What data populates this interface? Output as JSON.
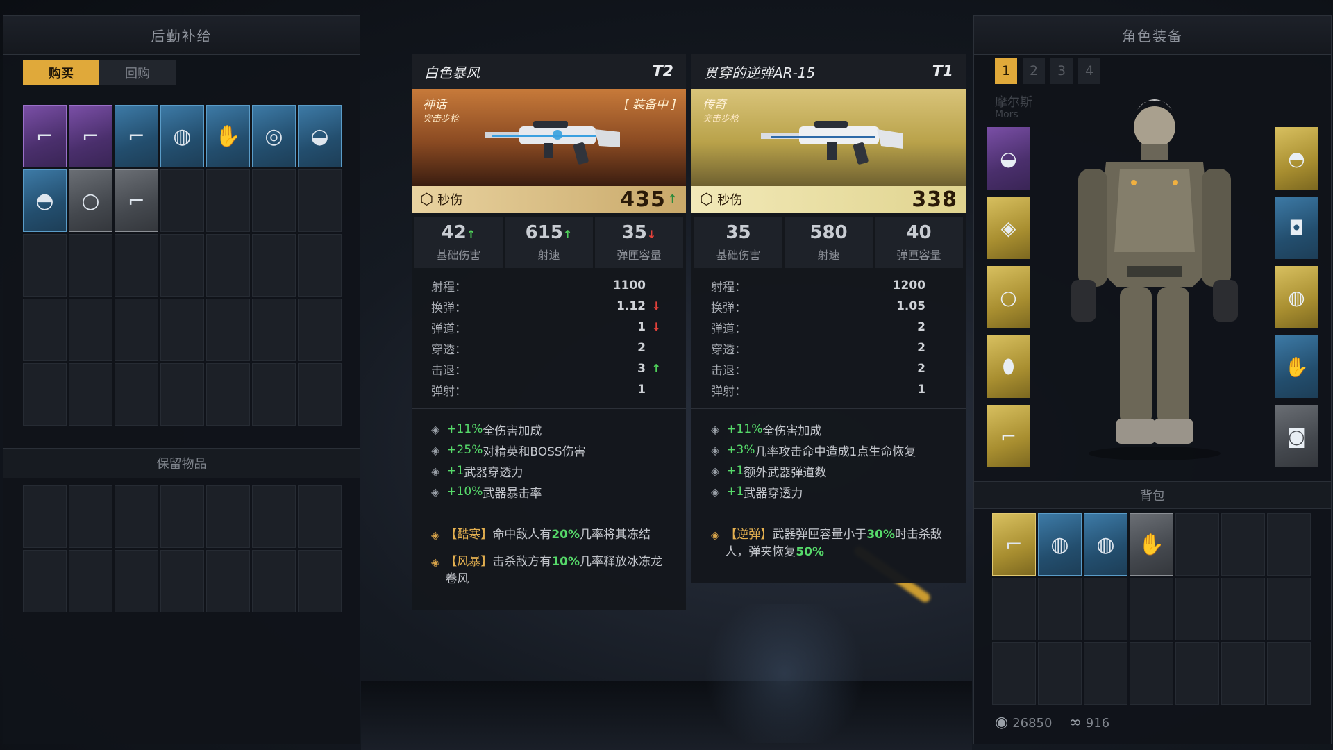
{
  "left_panel": {
    "title": "后勤补给",
    "tabs": [
      {
        "label": "购买",
        "active": true
      },
      {
        "label": "回购",
        "active": false
      }
    ],
    "shop_items": [
      {
        "icon": "assault-rifle-icon",
        "glyph": "⌐",
        "rarity": "epic"
      },
      {
        "icon": "assault-rifle-icon",
        "glyph": "⌐",
        "rarity": "epic"
      },
      {
        "icon": "rifle-icon",
        "glyph": "⌐",
        "rarity": "rare"
      },
      {
        "icon": "belt-icon",
        "glyph": "◍",
        "rarity": "rare"
      },
      {
        "icon": "glove-icon",
        "glyph": "✋",
        "rarity": "rare"
      },
      {
        "icon": "goggles-icon",
        "glyph": "◎",
        "rarity": "rare"
      },
      {
        "icon": "visor-icon",
        "glyph": "◒",
        "rarity": "rare"
      },
      {
        "icon": "helmet-icon",
        "glyph": "◓",
        "rarity": "rare"
      },
      {
        "icon": "ring-icon",
        "glyph": "○",
        "rarity": "common"
      },
      {
        "icon": "pistol-icon",
        "glyph": "⌐",
        "rarity": "common"
      }
    ],
    "reserve_title": "保留物品"
  },
  "weapon_left": {
    "name": "白色暴风",
    "tier": "T2",
    "rarity": "神话",
    "type": "突击步枪",
    "equipped": "[ 装备中 ]",
    "dps_label": "秒伤",
    "dps": "435",
    "stats": [
      {
        "value": "42",
        "label": "基础伤害",
        "trend": "up"
      },
      {
        "value": "615",
        "label": "射速",
        "trend": "up"
      },
      {
        "value": "35",
        "label": "弹匣容量",
        "trend": "down"
      }
    ],
    "props": [
      {
        "label": "射程：",
        "value": "1100",
        "trend": ""
      },
      {
        "label": "换弹：",
        "value": "1.12",
        "trend": "down"
      },
      {
        "label": "弹道：",
        "value": "1",
        "trend": "down"
      },
      {
        "label": "穿透：",
        "value": "2",
        "trend": ""
      },
      {
        "label": "击退：",
        "value": "3",
        "trend": "up"
      },
      {
        "label": "弹射：",
        "value": "1",
        "trend": ""
      }
    ],
    "bonuses": [
      {
        "pre": "+11%",
        "text": " 全伤害加成"
      },
      {
        "pre": "+25%",
        "text": " 对精英和BOSS伤害"
      },
      {
        "pre": "+1",
        "text": " 武器穿透力"
      },
      {
        "pre": "+10%",
        "text": "武器暴击率"
      }
    ],
    "skills": [
      {
        "name": "【酷寒】",
        "a": "命中敌人有",
        "hl": "20%",
        "b": "几率将其冻结"
      },
      {
        "name": "【风暴】",
        "a": "击杀敌方有",
        "hl": "10%",
        "b": "几率释放冰冻龙卷风"
      }
    ]
  },
  "weapon_right": {
    "name": "贯穿的逆弹AR-15",
    "tier": "T1",
    "rarity": "传奇",
    "type": "突击步枪",
    "dps_label": "秒伤",
    "dps": "338",
    "stats": [
      {
        "value": "35",
        "label": "基础伤害",
        "trend": ""
      },
      {
        "value": "580",
        "label": "射速",
        "trend": ""
      },
      {
        "value": "40",
        "label": "弹匣容量",
        "trend": ""
      }
    ],
    "props": [
      {
        "label": "射程：",
        "value": "1200",
        "trend": ""
      },
      {
        "label": "换弹：",
        "value": "1.05",
        "trend": ""
      },
      {
        "label": "弹道：",
        "value": "2",
        "trend": ""
      },
      {
        "label": "穿透：",
        "value": "2",
        "trend": ""
      },
      {
        "label": "击退：",
        "value": "2",
        "trend": ""
      },
      {
        "label": "弹射：",
        "value": "1",
        "trend": ""
      }
    ],
    "bonuses": [
      {
        "pre": "+11%",
        "text": " 全伤害加成"
      },
      {
        "pre": "+3%",
        "text": " 几率攻击命中造成1点生命恢复"
      },
      {
        "pre": "+1",
        "text": " 额外武器弹道数"
      },
      {
        "pre": "+1",
        "text": " 武器穿透力"
      }
    ],
    "skills": [
      {
        "name": "【逆弹】",
        "a": "武器弹匣容量小于",
        "hl": "30%",
        "b": "时击杀敌人，弹夹恢复",
        "hl2": "50%"
      }
    ]
  },
  "right_panel": {
    "title": "角色装备",
    "char_tabs": [
      "1",
      "2",
      "3",
      "4"
    ],
    "char_name": "摩尔斯",
    "char_name_en": "Mors",
    "left_slots": [
      {
        "icon": "visor-icon",
        "glyph": "◒",
        "rarity": "epic"
      },
      {
        "icon": "chip-icon",
        "glyph": "◈",
        "rarity": "legend"
      },
      {
        "icon": "ring-icon",
        "glyph": "○",
        "rarity": "legend"
      },
      {
        "icon": "grenade-icon",
        "glyph": "⬮",
        "rarity": "legend"
      },
      {
        "icon": "rifle-icon",
        "glyph": "⌐",
        "rarity": "legend"
      }
    ],
    "right_slots": [
      {
        "icon": "helmet-icon",
        "glyph": "◓",
        "rarity": "legend"
      },
      {
        "icon": "armor-icon",
        "glyph": "◘",
        "rarity": "rare"
      },
      {
        "icon": "belt-icon",
        "glyph": "◍",
        "rarity": "legend"
      },
      {
        "icon": "glove-icon",
        "glyph": "✋",
        "rarity": "rare"
      },
      {
        "icon": "boots-icon",
        "glyph": "◙",
        "rarity": "common"
      }
    ],
    "bag_title": "背包",
    "bag_items": [
      {
        "icon": "rifle-icon",
        "glyph": "⌐",
        "rarity": "legend"
      },
      {
        "icon": "belt-icon",
        "glyph": "◍",
        "rarity": "rare"
      },
      {
        "icon": "belt-icon",
        "glyph": "◍",
        "rarity": "rare"
      },
      {
        "icon": "glove-icon",
        "glyph": "✋",
        "rarity": "common"
      }
    ],
    "currency_1": "26850",
    "currency_2": "916"
  }
}
